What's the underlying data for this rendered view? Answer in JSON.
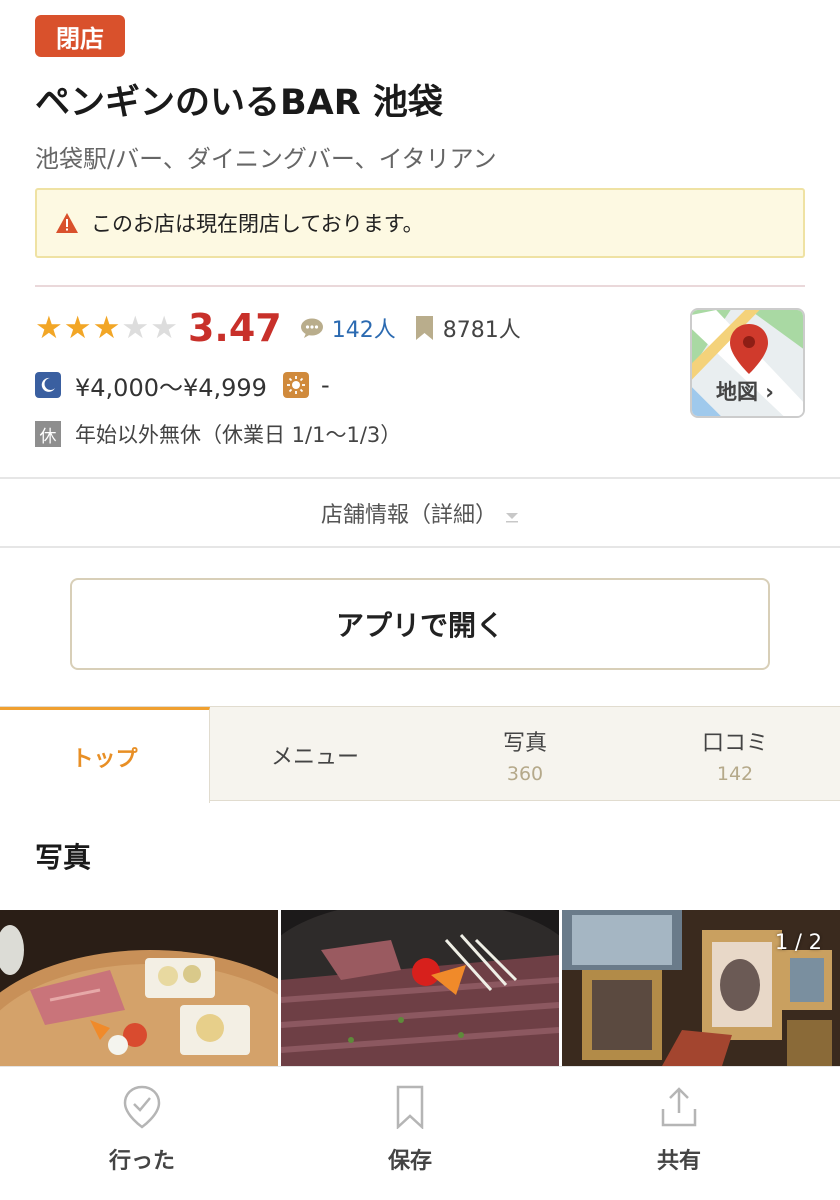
{
  "badge": {
    "closed": "閉店"
  },
  "shop": {
    "name": "ペンギンのいるBAR 池袋",
    "genre": "池袋駅/バー、ダイニングバー、イタリアン"
  },
  "notice": {
    "text": "このお店は現在閉店しております。",
    "icon": "warning-icon"
  },
  "rating": {
    "stars_filled": 3,
    "stars_total": 5,
    "score": "3.47",
    "reviews": "142人",
    "bookmarks": "8781人"
  },
  "price": {
    "dinner": "¥4,000～¥4,999",
    "lunch": "-"
  },
  "holiday": {
    "icon_label": "休",
    "text": "年始以外無休（休業日 1/1～1/3）"
  },
  "map": {
    "label": "地図"
  },
  "detail": {
    "label": "店舗情報（詳細）"
  },
  "app_button": {
    "label": "アプリで開く"
  },
  "tabs": [
    {
      "label": "トップ",
      "count": ""
    },
    {
      "label": "メニュー",
      "count": ""
    },
    {
      "label": "写真",
      "count": "360"
    },
    {
      "label": "口コミ",
      "count": "142"
    }
  ],
  "photos": {
    "heading": "写真",
    "pager": "1 / 2"
  },
  "bottom_nav": [
    {
      "label": "行った",
      "icon": "check-pin-icon"
    },
    {
      "label": "保存",
      "icon": "bookmark-icon"
    },
    {
      "label": "共有",
      "icon": "share-icon"
    }
  ],
  "colors": {
    "closed_badge": "#d9512c",
    "score": "#c8302a",
    "star": "#f2a626",
    "review_link": "#2b6ab1",
    "active_tab": "#e88f25",
    "notice_bg": "#fdf9e2"
  }
}
